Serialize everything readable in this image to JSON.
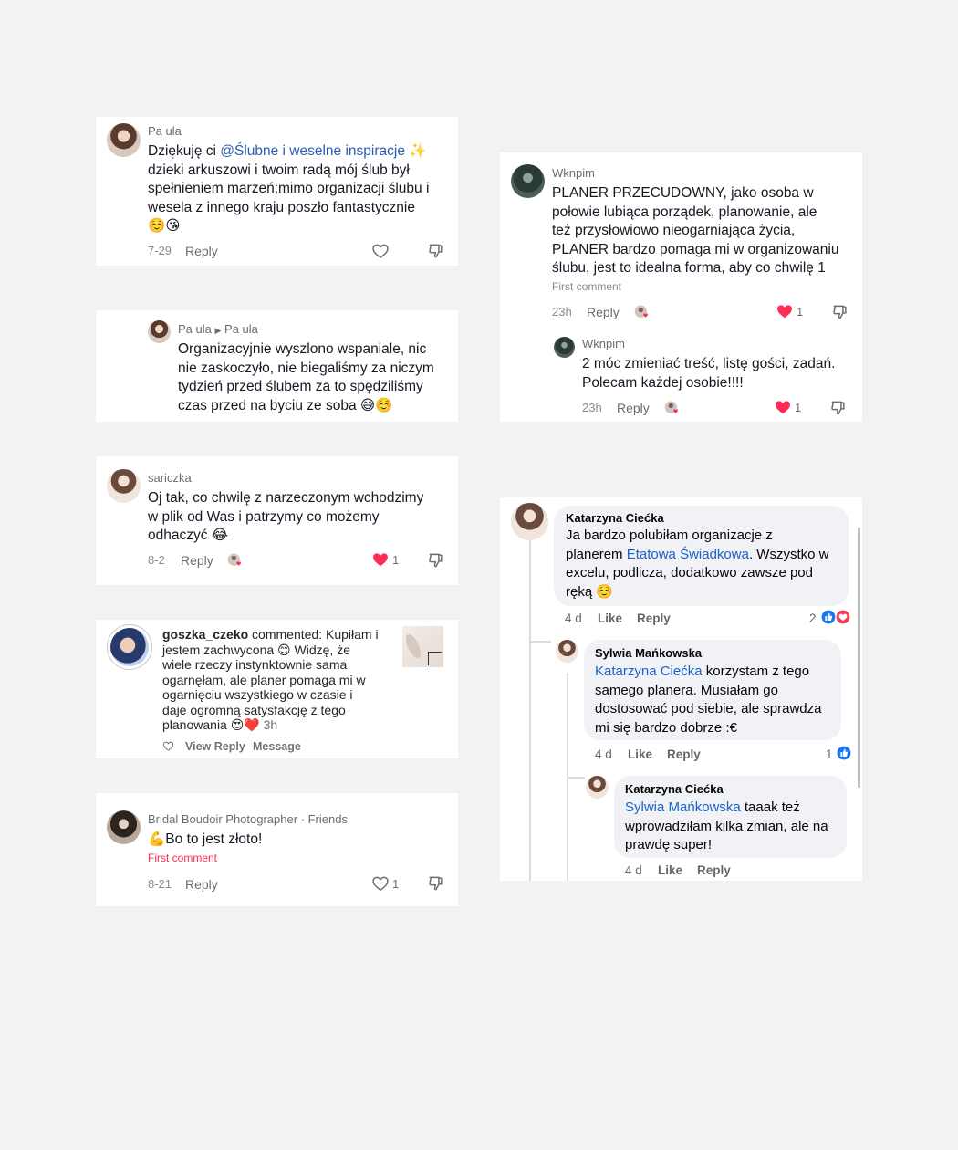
{
  "card1": {
    "user": "Pa ula",
    "text_before": "Dziękuję ci ",
    "mention": "@Ślubne i weselne inspiracje",
    "text_l1_end": " ✨",
    "text_l2": "dzieki arkuszowi i twoim radą mój ślub był",
    "text_l3": "spełnieniem marzeń;mimo organizacji ślubu i",
    "text_l4": "wesela z innego kraju poszło fantastycznie",
    "text_l5": "☺️😘",
    "date": "7-29",
    "reply": "Reply"
  },
  "card2": {
    "user": "Pa ula",
    "reply_to": "Pa ula",
    "l1": "Organizacyjnie wyszlono wspaniale, nic",
    "l2": "nie zaskoczyło, nie biegaliśmy za niczym",
    "l3": "tydzień przed ślubem za to spędziliśmy",
    "l4": "czas przed na byciu ze soba 😅☺️"
  },
  "card3": {
    "user": "sariczka",
    "l1": "Oj tak, co chwilę z narzeczonym wchodzimy",
    "l2": "w plik od Was i patrzymy co możemy",
    "l3": "odhaczyć 😂",
    "date": "8-2",
    "reply": "Reply",
    "likes": "1"
  },
  "card4": {
    "user": "goszka_czeko",
    "verb": " commented: Kupiłam i",
    "l2": "jestem zachwycona 😊 Widzę, że",
    "l3": "wiele rzeczy instynktownie sama",
    "l4": "ogarnęłam, ale planer pomaga mi w",
    "l5": "ogarnięciu wszystkiego w czasie i",
    "l6": "daje ogromną satysfakcję z tego",
    "l7": "planowania 😍❤️",
    "time": "3h",
    "view_reply": "View Reply",
    "message": "Message"
  },
  "card5": {
    "user": "Bridal Boudoir Photographer · Friends",
    "text": "💪Bo to jest złoto!",
    "first_comment": "First comment",
    "date": "8-21",
    "reply": "Reply",
    "likes": "1"
  },
  "card6": {
    "user": "Wknpim",
    "l1": "PLANER PRZECUDOWNY, jako osoba w",
    "l2": "połowie lubiąca porządek, planowanie, ale",
    "l3": "też przysłowiowo nieogarniająca życia,",
    "l4": "PLANER bardzo pomaga mi w organizowaniu",
    "l5": "ślubu, jest to idealna forma, aby co chwilę 1",
    "first_comment": "First comment",
    "date": "23h",
    "reply": "Reply",
    "likes": "1",
    "sub": {
      "user": "Wknpim",
      "l1": "2 móc zmieniać treść, listę gości, zadań.",
      "l2": "Polecam każdej osobie!!!!",
      "date": "23h",
      "reply": "Reply",
      "likes": "1"
    }
  },
  "card7": {
    "c1": {
      "name": "Katarzyna Ciećka",
      "l1": "Ja bardzo polubiłam organizacje z",
      "l2_before": "planerem ",
      "l2_link": "Etatowa Świadkowa",
      "l2_after": ". Wszystko w",
      "l3": "excelu, podlicza, dodatkowo zawsze pod",
      "l4": "ręką ☺️",
      "time": "4 d",
      "like": "Like",
      "reply": "Reply",
      "reactions": "2"
    },
    "c2": {
      "name": "Sylwia Mańkowska",
      "l1_link": "Katarzyna Ciećka",
      "l1_after": " korzystam z tego",
      "l2": "samego planera. Musiałam go",
      "l3": "dostosować pod siebie, ale sprawdza",
      "l4": "mi się bardzo dobrze :€",
      "time": "4 d",
      "like": "Like",
      "reply": "Reply",
      "reactions": "1"
    },
    "c3": {
      "name": "Katarzyna Ciećka",
      "l1_link": "Sylwia Mańkowska",
      "l1_after": " taaak też",
      "l2": "wprowadziłam kilka zmian, ale na",
      "l3": "prawdę super!",
      "time": "4 d",
      "like": "Like",
      "reply": "Reply"
    }
  }
}
